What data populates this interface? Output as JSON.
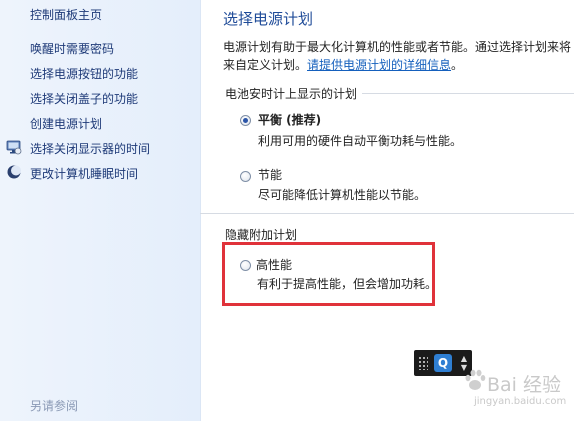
{
  "sidebar": {
    "home": "控制面板主页",
    "items": [
      {
        "label": "唤醒时需要密码",
        "icon": ""
      },
      {
        "label": "选择电源按钮的功能",
        "icon": ""
      },
      {
        "label": "选择关闭盖子的功能",
        "icon": ""
      },
      {
        "label": "创建电源计划",
        "icon": ""
      },
      {
        "label": "选择关闭显示器的时间",
        "icon": "monitor-icon"
      },
      {
        "label": "更改计算机睡眠时间",
        "icon": "moon-icon"
      }
    ],
    "see_also": "另请参阅"
  },
  "main": {
    "title": "选择电源计划",
    "description_line1": "电源计划有助于最大化计算机的性能或者节能。通过选择计划来将",
    "description_line2_prefix": "来自定义计划。",
    "description_link": "请提供电源计划的详细信息",
    "description_line2_suffix": "。",
    "battery_group": {
      "label": "电池安时计上显示的计划",
      "plans": [
        {
          "name": "平衡 (推荐)",
          "description": "利用可用的硬件自动平衡功耗与性能。",
          "selected": true
        },
        {
          "name": "节能",
          "description": "尽可能降低计算机性能以节能。",
          "selected": false
        }
      ]
    },
    "hidden_group": {
      "label": "隐藏附加计划",
      "plans": [
        {
          "name": "高性能",
          "description": "有利于提高性能，但会增加功耗。",
          "selected": false
        }
      ]
    }
  },
  "overlay": {
    "widget_letter": "Q",
    "watermark_text": "Bai 经验",
    "watermark_sub": "jingyan.baidu.com"
  },
  "colors": {
    "highlight": "#e0323a",
    "title": "#1f4b98",
    "link": "#1560bd",
    "sidebar_link": "#1e3a78"
  }
}
